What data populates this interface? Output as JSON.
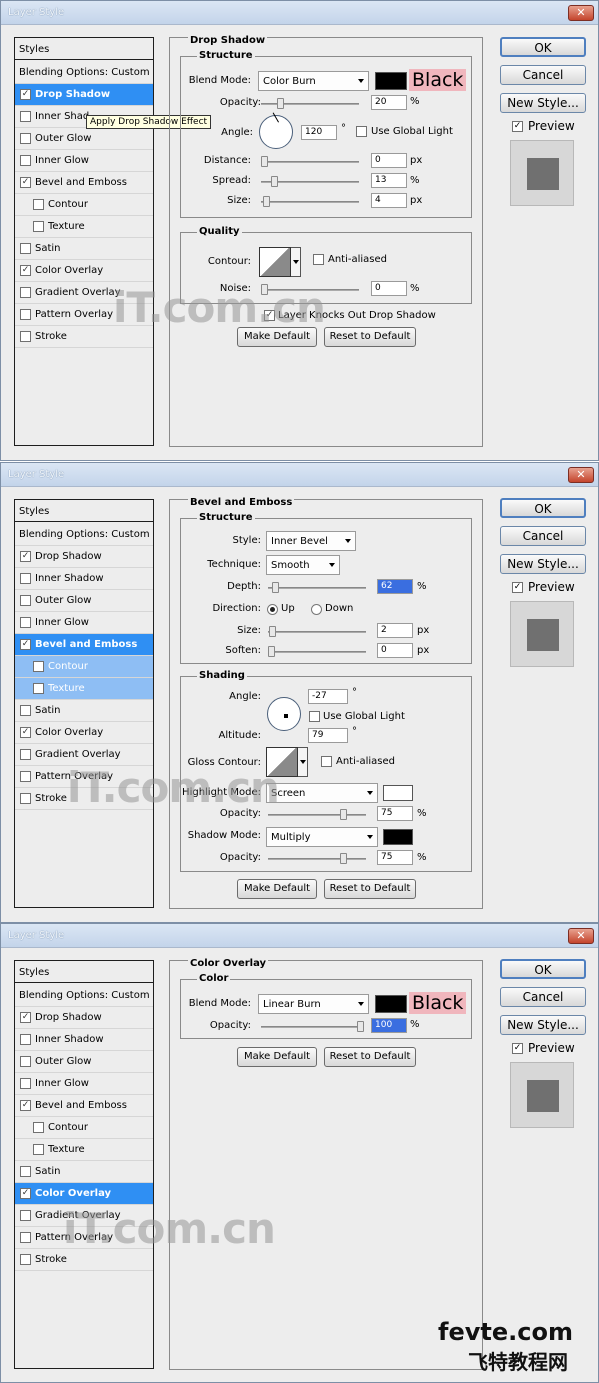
{
  "dialog_title": "Layer Style",
  "close_glyph": "✕",
  "right_buttons": {
    "ok": "OK",
    "cancel": "Cancel",
    "new_style": "New Style...",
    "preview": "Preview"
  },
  "styles_header": "Styles",
  "style_items": [
    "Blending Options: Custom",
    "Drop Shadow",
    "Inner Shadow",
    "Outer Glow",
    "Inner Glow",
    "Bevel and Emboss",
    "Contour",
    "Texture",
    "Satin",
    "Color Overlay",
    "Gradient Overlay",
    "Pattern Overlay",
    "Stroke"
  ],
  "inner_shadow_truncated": "Inner Shad",
  "check_glyph": "✓",
  "tooltip": "Apply Drop Shadow Effect",
  "common": {
    "make_default": "Make Default",
    "reset_to_default": "Reset to Default",
    "percent": "%",
    "px": "px",
    "degree": "°"
  },
  "drop_shadow": {
    "title": "Drop Shadow",
    "structure": "Structure",
    "blend_mode_label": "Blend Mode:",
    "blend_mode": "Color Burn",
    "color_note": "Black",
    "opacity_label": "Opacity:",
    "opacity": "20",
    "angle_label": "Angle:",
    "angle": "120",
    "use_global_light": "Use Global Light",
    "distance_label": "Distance:",
    "distance": "0",
    "spread_label": "Spread:",
    "spread": "13",
    "size_label": "Size:",
    "size": "4",
    "quality": "Quality",
    "contour_label": "Contour:",
    "anti_aliased": "Anti-aliased",
    "noise_label": "Noise:",
    "noise": "0",
    "knocks_out": "Layer Knocks Out Drop Shadow",
    "shadow_color": "#000000"
  },
  "bevel_emboss": {
    "title": "Bevel and Emboss",
    "structure": "Structure",
    "style_label": "Style:",
    "style": "Inner Bevel",
    "technique_label": "Technique:",
    "technique": "Smooth",
    "depth_label": "Depth:",
    "depth": "62",
    "direction_label": "Direction:",
    "up": "Up",
    "down": "Down",
    "size_label": "Size:",
    "size": "2",
    "soften_label": "Soften:",
    "soften": "0",
    "shading": "Shading",
    "angle_label": "Angle:",
    "angle": "-27",
    "use_global_light": "Use Global Light",
    "altitude_label": "Altitude:",
    "altitude": "79",
    "gloss_contour_label": "Gloss Contour:",
    "anti_aliased": "Anti-aliased",
    "highlight_mode_label": "Highlight Mode:",
    "highlight_mode": "Screen",
    "highlight_opacity_label": "Opacity:",
    "highlight_opacity": "75",
    "shadow_mode_label": "Shadow Mode:",
    "shadow_mode": "Multiply",
    "shadow_opacity_label": "Opacity:",
    "shadow_opacity": "75",
    "highlight_color": "#ffffff",
    "shadow_color": "#000000"
  },
  "color_overlay": {
    "title": "Color Overlay",
    "color": "Color",
    "blend_mode_label": "Blend Mode:",
    "blend_mode": "Linear Burn",
    "color_note": "Black",
    "opacity_label": "Opacity:",
    "opacity": "100",
    "overlay_color": "#000000"
  },
  "watermark": "iT.com.cn",
  "site_name": "fevte.com",
  "site_name_cn": "飞特教程网"
}
